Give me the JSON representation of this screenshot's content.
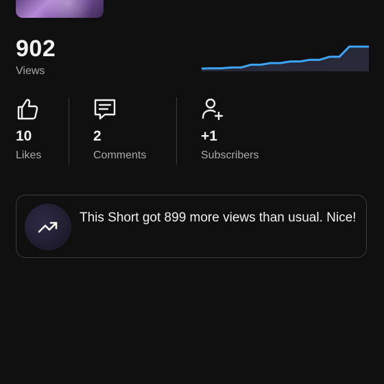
{
  "summary": {
    "views_value": "902",
    "views_label": "Views",
    "sparkline": {
      "line_color": "#3ea6ff",
      "fill_color": "#272838",
      "values": [
        0.05,
        0.06,
        0.06,
        0.09,
        0.09,
        0.19,
        0.19,
        0.25,
        0.25,
        0.31,
        0.31,
        0.37,
        0.37,
        0.48,
        0.48,
        0.85,
        0.85,
        0.85
      ]
    }
  },
  "stats": [
    {
      "icon": "thumbs-up-icon",
      "value": "10",
      "label": "Likes"
    },
    {
      "icon": "comment-icon",
      "value": "2",
      "label": "Comments"
    },
    {
      "icon": "add-person-icon",
      "value": "+1",
      "label": "Subscribers"
    }
  ],
  "insight": {
    "icon": "trending-up-icon",
    "message": "This Short got 899 more views than usual. Nice!"
  }
}
